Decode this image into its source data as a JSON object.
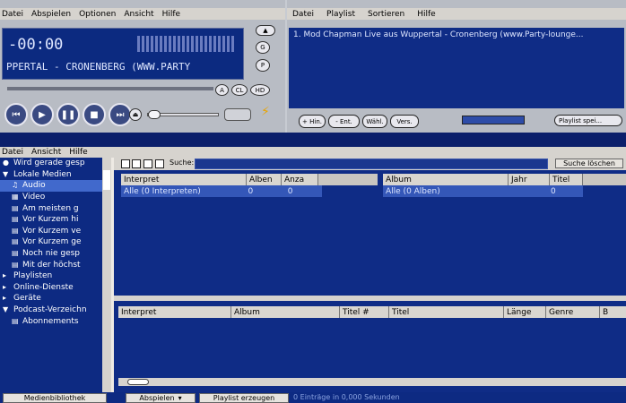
{
  "player": {
    "menu": [
      "Datei",
      "Abspielen",
      "Optionen",
      "Ansicht",
      "Hilfe"
    ],
    "time": "-00:00",
    "marquee": "PPERTAL - CRONENBERG (WWW.PARTY",
    "controls": [
      "prev",
      "play",
      "pause",
      "stop",
      "next"
    ]
  },
  "playlist": {
    "menu": [
      "Datei",
      "Playlist",
      "Sortieren",
      "Hilfe"
    ],
    "items": [
      "1. Mod Chapman  Live aus Wuppertal - Cronenberg (www.Party-lounge..."
    ],
    "buttons": [
      "+ Hin.",
      "- Ent.",
      "Wähl.",
      "Vers."
    ],
    "playlist_save": "Playlist spei..."
  },
  "library": {
    "menu": [
      "Datei",
      "Ansicht",
      "Hilfe"
    ],
    "nav": [
      {
        "label": "Wird gerade gesp",
        "icon": "disc-icon",
        "indent": 0
      },
      {
        "label": "Lokale Medien",
        "icon": "expand-icon",
        "indent": 0
      },
      {
        "label": "Audio",
        "icon": "audio-icon",
        "indent": 1,
        "selected": true
      },
      {
        "label": "Video",
        "icon": "video-icon",
        "indent": 1
      },
      {
        "label": "Am meisten g",
        "icon": "doc-icon",
        "indent": 1
      },
      {
        "label": "Vor Kurzem hi",
        "icon": "doc-icon",
        "indent": 1
      },
      {
        "label": "Vor Kurzem ve",
        "icon": "doc-icon",
        "indent": 1
      },
      {
        "label": "Vor Kurzem ge",
        "icon": "doc-icon",
        "indent": 1
      },
      {
        "label": "Noch nie gesp",
        "icon": "doc-icon",
        "indent": 1
      },
      {
        "label": "Mit der höchst",
        "icon": "doc-icon",
        "indent": 1
      },
      {
        "label": "Playlisten",
        "icon": "collapse-icon",
        "indent": 0
      },
      {
        "label": "Online-Dienste",
        "icon": "collapse-icon",
        "indent": 0
      },
      {
        "label": "Geräte",
        "icon": "collapse-icon",
        "indent": 0
      },
      {
        "label": "Podcast-Verzeichn",
        "icon": "expand-icon",
        "indent": 0
      },
      {
        "label": "Abonnements",
        "icon": "rss-icon",
        "indent": 1
      }
    ],
    "search_label": "Suche:",
    "search_value": "",
    "search_clear": "Suche löschen",
    "artist_headers": [
      "Interpret",
      "Alben",
      "Anza"
    ],
    "artist_row": [
      "Alle (0 Interpreten)",
      "0",
      "0"
    ],
    "album_headers": [
      "Album",
      "Jahr",
      "Titel"
    ],
    "album_row": [
      "Alle (0 Alben)",
      "",
      "0"
    ],
    "track_headers": [
      "Interpret",
      "Album",
      "Titel #",
      "Titel",
      "Länge",
      "Genre",
      "B"
    ],
    "bottom_tab": "Medienbibliothek",
    "play_button": "Abspielen",
    "create_playlist": "Playlist erzeugen",
    "status": "0 Einträge in 0,000 Sekunden"
  },
  "colors": {
    "panel": "#0f2c86",
    "selection": "#4169cc",
    "chrome": "#d6d3ce"
  }
}
